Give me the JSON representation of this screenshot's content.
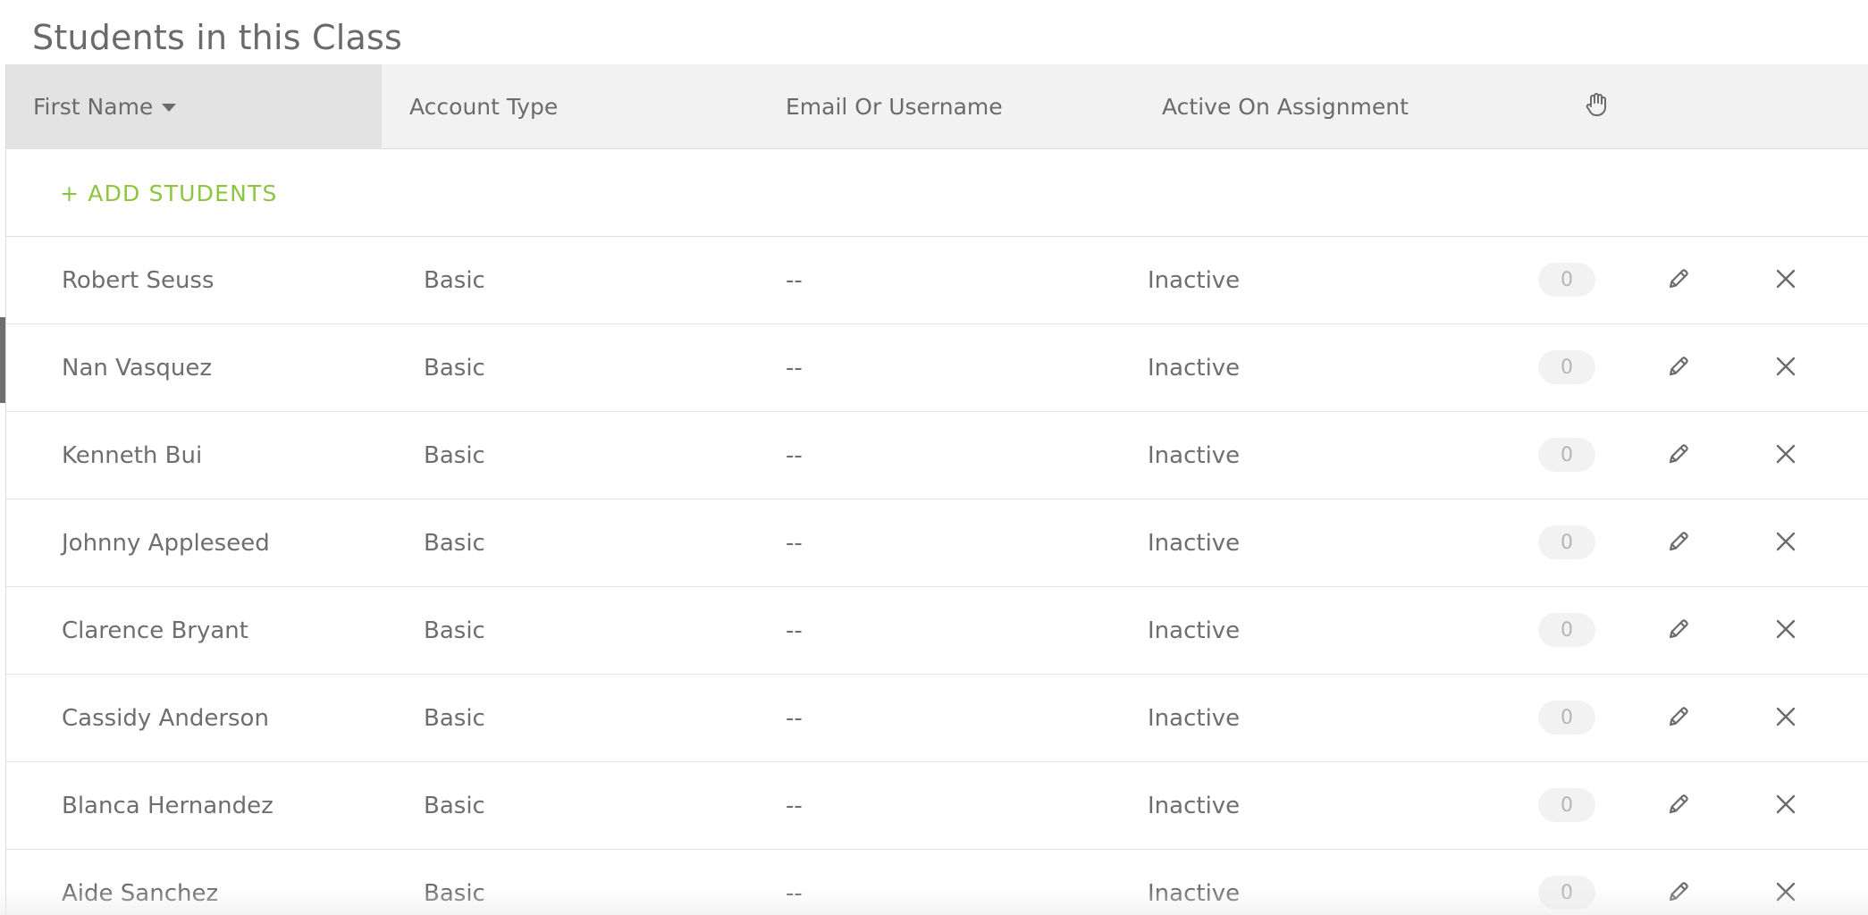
{
  "page": {
    "title": "Students in this Class"
  },
  "table": {
    "columns": {
      "first_name": "First Name",
      "account_type": "Account Type",
      "email": "Email Or Username",
      "active": "Active On Assignment",
      "raise_hand_icon": "hand-icon"
    },
    "sort": {
      "column": "first_name",
      "direction": "descending"
    },
    "add_label": "+ ADD STUDENTS",
    "rows": [
      {
        "name": "Robert Seuss",
        "account_type": "Basic",
        "email": "--",
        "status": "Inactive",
        "count": "0"
      },
      {
        "name": "Nan Vasquez",
        "account_type": "Basic",
        "email": "--",
        "status": "Inactive",
        "count": "0"
      },
      {
        "name": "Kenneth Bui",
        "account_type": "Basic",
        "email": "--",
        "status": "Inactive",
        "count": "0"
      },
      {
        "name": "Johnny Appleseed",
        "account_type": "Basic",
        "email": "--",
        "status": "Inactive",
        "count": "0"
      },
      {
        "name": "Clarence Bryant",
        "account_type": "Basic",
        "email": "--",
        "status": "Inactive",
        "count": "0"
      },
      {
        "name": "Cassidy Anderson",
        "account_type": "Basic",
        "email": "--",
        "status": "Inactive",
        "count": "0"
      },
      {
        "name": "Blanca Hernandez",
        "account_type": "Basic",
        "email": "--",
        "status": "Inactive",
        "count": "0"
      },
      {
        "name": "Aide Sanchez",
        "account_type": "Basic",
        "email": "--",
        "status": "Inactive",
        "count": "0"
      }
    ]
  },
  "colors": {
    "accent": "#8cc63f",
    "header_bg": "#f2f2f2",
    "sorted_header_bg": "#e3e3e3",
    "text": "#6e6e6e",
    "badge_bg": "#f2f2f2"
  }
}
